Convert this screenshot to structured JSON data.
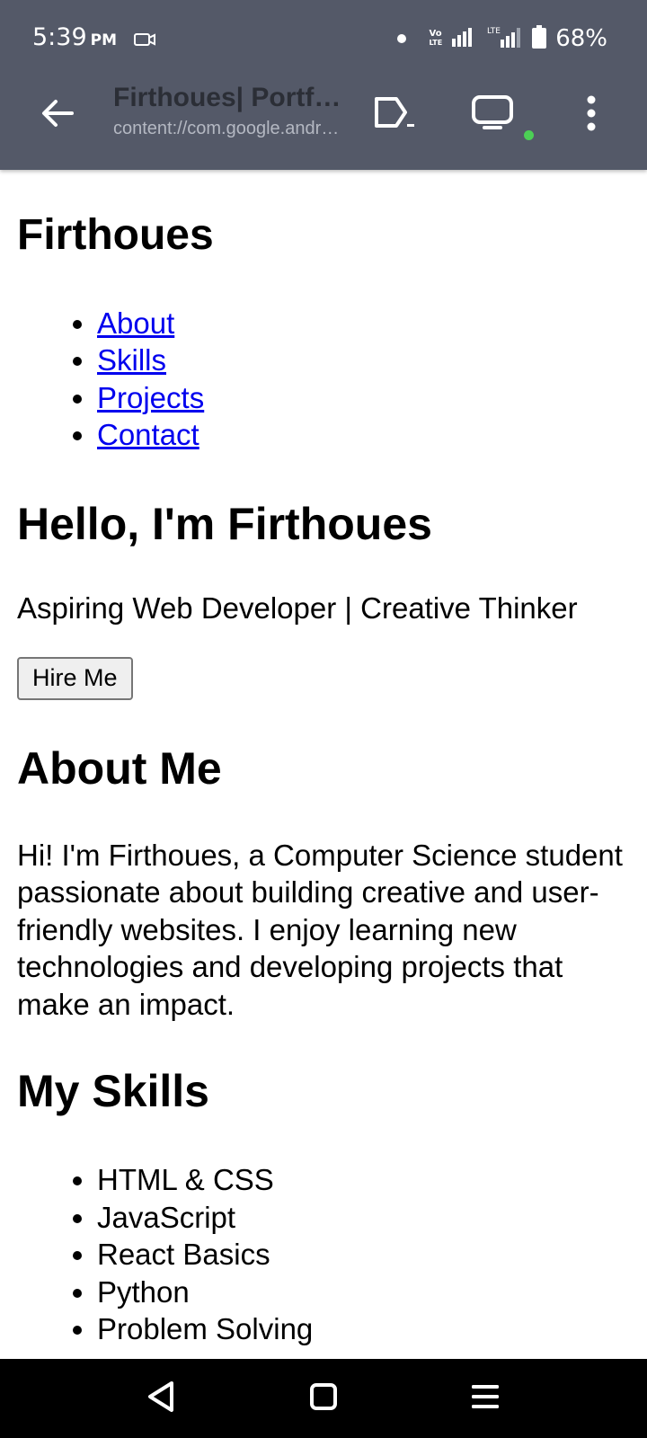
{
  "status_bar": {
    "time": "5:39",
    "ampm": "PM",
    "volte_top": "Vo",
    "volte_bottom": "LTE",
    "battery_percent": "68%"
  },
  "toolbar": {
    "title": "Firthoues| Portfolio",
    "url": "content://com.google.android.apps.docs.storage"
  },
  "page": {
    "site_name": "Firthoues",
    "nav": [
      "About",
      "Skills",
      "Projects",
      "Contact"
    ],
    "hero_title": "Hello, I'm Firthoues",
    "hero_subtitle": "Aspiring Web Developer | Creative Thinker",
    "hire_button": "Hire Me",
    "about_title": "About Me",
    "about_text": "Hi! I'm Firthoues, a Computer Science student passionate about building creative and user-friendly websites. I enjoy learning new technologies and developing projects that make an impact.",
    "skills_title": "My Skills",
    "skills": [
      "HTML & CSS",
      "JavaScript",
      "React Basics",
      "Python",
      "Problem Solving"
    ]
  },
  "colors": {
    "toolbar_bg": "#545968",
    "link": "#0000ee",
    "live_indicator": "#4ccf55",
    "nav_bar_bg": "#000000"
  },
  "icons": {
    "status": [
      "screen-record-icon",
      "notification-dot-icon",
      "volte-icon",
      "signal-icon",
      "lte-signal-icon",
      "battery-icon"
    ],
    "toolbar": [
      "back-arrow-icon",
      "share-icon",
      "cast-screen-icon",
      "more-vertical-icon"
    ],
    "nav_bar": [
      "nav-back-icon",
      "nav-home-icon",
      "nav-recents-icon"
    ]
  }
}
